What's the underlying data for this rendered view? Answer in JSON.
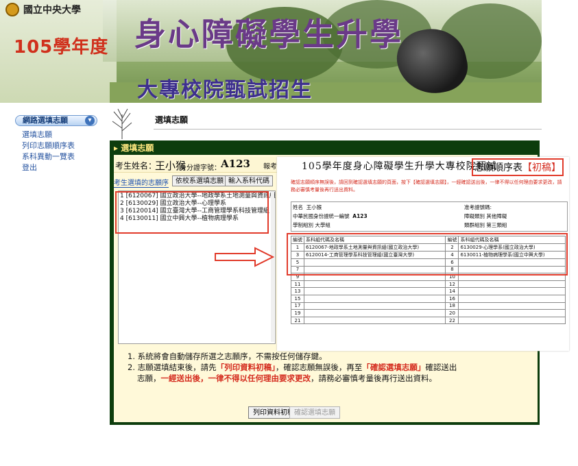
{
  "banner": {
    "university": "國立中央大學",
    "year": "105學年度",
    "title": "身心障礙學生升學",
    "subtitle": "大專校院甄試招生"
  },
  "sidebar": {
    "menu_header": "網路選填志願",
    "items": [
      {
        "label": "選填志願"
      },
      {
        "label": "列印志願順序表"
      },
      {
        "label": "系科異動一覽表"
      },
      {
        "label": "登出"
      }
    ]
  },
  "content": {
    "section_title": "選填志願",
    "panel_title": "選填志願",
    "student_label": "考生姓名：",
    "student_name": "王小猴",
    "id_label": "身分證字號：",
    "id_value": "A123",
    "exam_label": "報考"
  },
  "tabs": [
    {
      "label": "考生選填的志願序"
    },
    {
      "label": "依校系選填志願"
    },
    {
      "label": "輸入系科代碼"
    }
  ],
  "choices": [
    "1 [6120067] 國立政治大學--地政學系土地測量與資訊組",
    "2 [6130029] 國立政治大學--心理學系",
    "3 [6120014] 國立臺灣大學--工商管理學系科技管理組",
    "4 [6130011] 國立中興大學--植物病理學系"
  ],
  "instructions": {
    "line1": "1. 系統將會自動儲存所選之志願序，不需按任何儲存鍵。",
    "line2_a": "2. 志願選填結束後，請先",
    "line2_red1": "「列印資料初稿」",
    "line2_b": "，確認志願無誤後，再至",
    "line2_red2": "「確認選填志願」",
    "line2_c": "確認送出",
    "line3_a": "志願，",
    "line3_red": "一經送出後，一律不得以任何理由要求更改",
    "line3_b": "，請務必審慎考量後再行送出資料。"
  },
  "buttons": {
    "print": "列印資料初稿",
    "confirm": "確認選填志願"
  },
  "document": {
    "title": "105學年度身心障礙學生升學大專校院甄試",
    "title_suffix": "志願順序表",
    "title_red": "【初稿】",
    "notice": "確認志願順序無誤後，請回到確認選填志願的頁面，按下【確認選填志願】，一經確認送出後，一律不得以任何理由要求更改，請務必審慎考量後再行送出資料。",
    "info": {
      "name_label": "姓名",
      "name_value": "王小猴",
      "id_label": "中華民國身份證統一編號",
      "id_value": "A123",
      "group_label": "學制組別",
      "group_value": "大學組",
      "exam_no_label": "准考證號碼:",
      "disability_label": "障礙類別",
      "disability_value": "其他障礙",
      "category_label": "類群組別",
      "category_value": "第三類組"
    },
    "table_header": {
      "no": "編號",
      "name": "系科組代碼及名稱"
    },
    "rows": [
      {
        "no1": "1",
        "name1": "6120067-地政學系土地測量與資訊組(國立政治大學)",
        "no2": "2",
        "name2": "6130029-心理學系(國立政治大學)"
      },
      {
        "no1": "3",
        "name1": "6120014-工商管理學系科技管理組(國立臺灣大學)",
        "no2": "4",
        "name2": "6130011-植物病理學系(國立中興大學)"
      },
      {
        "no1": "5",
        "name1": "",
        "no2": "6",
        "name2": ""
      },
      {
        "no1": "7",
        "name1": "",
        "no2": "8",
        "name2": ""
      },
      {
        "no1": "9",
        "name1": "",
        "no2": "10",
        "name2": ""
      },
      {
        "no1": "11",
        "name1": "",
        "no2": "12",
        "name2": ""
      },
      {
        "no1": "13",
        "name1": "",
        "no2": "14",
        "name2": ""
      },
      {
        "no1": "15",
        "name1": "",
        "no2": "16",
        "name2": ""
      },
      {
        "no1": "17",
        "name1": "",
        "no2": "18",
        "name2": ""
      },
      {
        "no1": "19",
        "name1": "",
        "no2": "20",
        "name2": ""
      },
      {
        "no1": "21",
        "name1": "",
        "no2": "22",
        "name2": ""
      }
    ]
  },
  "icons": {
    "logo": "university-logo-icon",
    "menu_toggle": "chevron-down-icon",
    "arrow": "right-arrow-icon"
  },
  "colors": {
    "panel_green": "#0d3d0d",
    "panel_bg": "#fff9d9",
    "accent_red": "#d42a1d",
    "link_blue": "#2754a0"
  }
}
